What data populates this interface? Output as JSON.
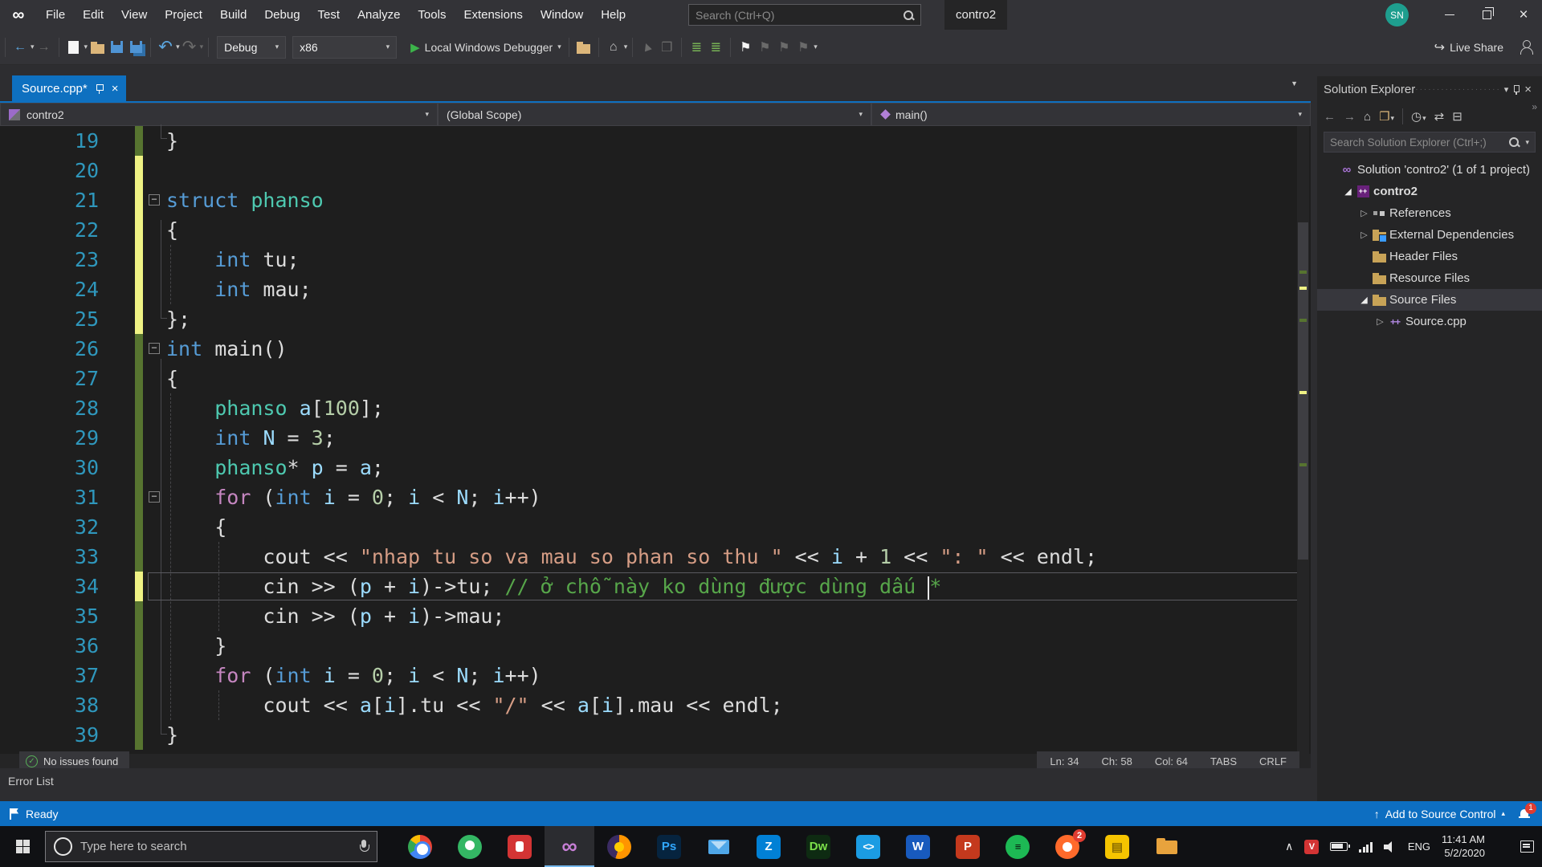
{
  "colors": {
    "accent_blue": "#0E70C0",
    "statusbar_blue": "#0D6EC1",
    "modified_yellow": "#EFF284",
    "saved_green": "#577430",
    "avatar_teal": "#1E9E8E"
  },
  "title_bar": {
    "menus": [
      "File",
      "Edit",
      "View",
      "Project",
      "Build",
      "Debug",
      "Test",
      "Analyze",
      "Tools",
      "Extensions",
      "Window",
      "Help"
    ],
    "search_placeholder": "Search (Ctrl+Q)",
    "window_title": "contro2",
    "avatar_initials": "SN"
  },
  "toolbar": {
    "configuration": "Debug",
    "platform": "x86",
    "run_label": "Local Windows Debugger",
    "live_share": "Live Share"
  },
  "editor": {
    "tab_label": "Source.cpp*",
    "navbar": {
      "project": "contro2",
      "scope": "(Global Scope)",
      "member": "main()"
    },
    "first_line": 19,
    "lines": [
      {
        "n": 19,
        "gutter": "g",
        "seg": [
          {
            "c": "pl",
            "t": "}"
          }
        ]
      },
      {
        "n": 20,
        "gutter": "y",
        "seg": []
      },
      {
        "n": 21,
        "gutter": "y",
        "fold": true,
        "seg": [
          {
            "c": "kw",
            "t": "struct"
          },
          {
            "c": "pl",
            "t": " "
          },
          {
            "c": "type",
            "t": "phanso"
          }
        ]
      },
      {
        "n": 22,
        "gutter": "y",
        "seg": [
          {
            "c": "pl",
            "t": "{"
          }
        ]
      },
      {
        "n": 23,
        "gutter": "y",
        "seg": [
          {
            "c": "pl",
            "t": "    "
          },
          {
            "c": "kw",
            "t": "int"
          },
          {
            "c": "pl",
            "t": " tu;"
          }
        ]
      },
      {
        "n": 24,
        "gutter": "y",
        "seg": [
          {
            "c": "pl",
            "t": "    "
          },
          {
            "c": "kw",
            "t": "int"
          },
          {
            "c": "pl",
            "t": " mau;"
          }
        ]
      },
      {
        "n": 25,
        "gutter": "y",
        "seg": [
          {
            "c": "pl",
            "t": "};"
          }
        ]
      },
      {
        "n": 26,
        "gutter": "g",
        "fold": true,
        "seg": [
          {
            "c": "kw",
            "t": "int"
          },
          {
            "c": "pl",
            "t": " main()"
          }
        ]
      },
      {
        "n": 27,
        "gutter": "g",
        "seg": [
          {
            "c": "pl",
            "t": "{"
          }
        ]
      },
      {
        "n": 28,
        "gutter": "g",
        "seg": [
          {
            "c": "pl",
            "t": "    "
          },
          {
            "c": "type",
            "t": "phanso"
          },
          {
            "c": "pl",
            "t": " "
          },
          {
            "c": "var",
            "t": "a"
          },
          {
            "c": "pl",
            "t": "["
          },
          {
            "c": "num",
            "t": "100"
          },
          {
            "c": "pl",
            "t": "];"
          }
        ]
      },
      {
        "n": 29,
        "gutter": "g",
        "seg": [
          {
            "c": "pl",
            "t": "    "
          },
          {
            "c": "kw",
            "t": "int"
          },
          {
            "c": "pl",
            "t": " "
          },
          {
            "c": "var",
            "t": "N"
          },
          {
            "c": "pl",
            "t": " = "
          },
          {
            "c": "num",
            "t": "3"
          },
          {
            "c": "pl",
            "t": ";"
          }
        ]
      },
      {
        "n": 30,
        "gutter": "g",
        "seg": [
          {
            "c": "pl",
            "t": "    "
          },
          {
            "c": "type",
            "t": "phanso"
          },
          {
            "c": "pl",
            "t": "* "
          },
          {
            "c": "var",
            "t": "p"
          },
          {
            "c": "pl",
            "t": " = "
          },
          {
            "c": "var",
            "t": "a"
          },
          {
            "c": "pl",
            "t": ";"
          }
        ]
      },
      {
        "n": 31,
        "gutter": "g",
        "fold": true,
        "seg": [
          {
            "c": "pl",
            "t": "    "
          },
          {
            "c": "ctl",
            "t": "for"
          },
          {
            "c": "pl",
            "t": " ("
          },
          {
            "c": "kw",
            "t": "int"
          },
          {
            "c": "pl",
            "t": " "
          },
          {
            "c": "var",
            "t": "i"
          },
          {
            "c": "pl",
            "t": " = "
          },
          {
            "c": "num",
            "t": "0"
          },
          {
            "c": "pl",
            "t": "; "
          },
          {
            "c": "var",
            "t": "i"
          },
          {
            "c": "pl",
            "t": " < "
          },
          {
            "c": "var",
            "t": "N"
          },
          {
            "c": "pl",
            "t": "; "
          },
          {
            "c": "var",
            "t": "i"
          },
          {
            "c": "pl",
            "t": "++)"
          }
        ]
      },
      {
        "n": 32,
        "gutter": "g",
        "seg": [
          {
            "c": "pl",
            "t": "    {"
          }
        ]
      },
      {
        "n": 33,
        "gutter": "g",
        "seg": [
          {
            "c": "pl",
            "t": "        cout << "
          },
          {
            "c": "str",
            "t": "\"nhap tu so va mau so phan so thu \""
          },
          {
            "c": "pl",
            "t": " << "
          },
          {
            "c": "var",
            "t": "i"
          },
          {
            "c": "pl",
            "t": " + "
          },
          {
            "c": "num",
            "t": "1"
          },
          {
            "c": "pl",
            "t": " << "
          },
          {
            "c": "str",
            "t": "\": \""
          },
          {
            "c": "pl",
            "t": " << endl;"
          }
        ]
      },
      {
        "n": 34,
        "gutter": "y",
        "current": true,
        "seg": [
          {
            "c": "pl",
            "t": "        cin >> ("
          },
          {
            "c": "var",
            "t": "p"
          },
          {
            "c": "pl",
            "t": " + "
          },
          {
            "c": "var",
            "t": "i"
          },
          {
            "c": "pl",
            "t": ")->tu; "
          },
          {
            "c": "com",
            "t": "// ở chỗ này ko dùng được dùng dấu "
          },
          {
            "c": "caret",
            "t": ""
          },
          {
            "c": "com",
            "t": "*"
          }
        ]
      },
      {
        "n": 35,
        "gutter": "g",
        "seg": [
          {
            "c": "pl",
            "t": "        cin >> ("
          },
          {
            "c": "var",
            "t": "p"
          },
          {
            "c": "pl",
            "t": " + "
          },
          {
            "c": "var",
            "t": "i"
          },
          {
            "c": "pl",
            "t": ")->mau;"
          }
        ]
      },
      {
        "n": 36,
        "gutter": "g",
        "seg": [
          {
            "c": "pl",
            "t": "    }"
          }
        ]
      },
      {
        "n": 37,
        "gutter": "g",
        "seg": [
          {
            "c": "pl",
            "t": "    "
          },
          {
            "c": "ctl",
            "t": "for"
          },
          {
            "c": "pl",
            "t": " ("
          },
          {
            "c": "kw",
            "t": "int"
          },
          {
            "c": "pl",
            "t": " "
          },
          {
            "c": "var",
            "t": "i"
          },
          {
            "c": "pl",
            "t": " = "
          },
          {
            "c": "num",
            "t": "0"
          },
          {
            "c": "pl",
            "t": "; "
          },
          {
            "c": "var",
            "t": "i"
          },
          {
            "c": "pl",
            "t": " < "
          },
          {
            "c": "var",
            "t": "N"
          },
          {
            "c": "pl",
            "t": "; "
          },
          {
            "c": "var",
            "t": "i"
          },
          {
            "c": "pl",
            "t": "++)"
          }
        ]
      },
      {
        "n": 38,
        "gutter": "g",
        "seg": [
          {
            "c": "pl",
            "t": "        cout << "
          },
          {
            "c": "var",
            "t": "a"
          },
          {
            "c": "pl",
            "t": "["
          },
          {
            "c": "var",
            "t": "i"
          },
          {
            "c": "pl",
            "t": "].tu << "
          },
          {
            "c": "str",
            "t": "\"/\""
          },
          {
            "c": "pl",
            "t": " << "
          },
          {
            "c": "var",
            "t": "a"
          },
          {
            "c": "pl",
            "t": "["
          },
          {
            "c": "var",
            "t": "i"
          },
          {
            "c": "pl",
            "t": "].mau << endl;"
          }
        ]
      },
      {
        "n": 39,
        "gutter": "g",
        "seg": [
          {
            "c": "pl",
            "t": "}"
          }
        ]
      }
    ],
    "health": "No issues found",
    "status_items": [
      "Ln: 34",
      "Ch: 58",
      "Col: 64",
      "TABS",
      "CRLF"
    ]
  },
  "solution_explorer": {
    "title": "Solution Explorer",
    "search_placeholder": "Search Solution Explorer (Ctrl+;)",
    "tree": [
      {
        "label": "Solution 'contro2' (1 of 1 project)",
        "indent": 0,
        "icon": "solution",
        "expand": "none"
      },
      {
        "label": "contro2",
        "indent": 1,
        "icon": "project",
        "expand": "open",
        "bold": true
      },
      {
        "label": "References",
        "indent": 2,
        "icon": "ref",
        "expand": "closed"
      },
      {
        "label": "External Dependencies",
        "indent": 2,
        "icon": "folder-ext",
        "expand": "closed"
      },
      {
        "label": "Header Files",
        "indent": 2,
        "icon": "folder",
        "expand": "none"
      },
      {
        "label": "Resource Files",
        "indent": 2,
        "icon": "folder",
        "expand": "none"
      },
      {
        "label": "Source Files",
        "indent": 2,
        "icon": "folder",
        "expand": "open",
        "selected": true
      },
      {
        "label": "Source.cpp",
        "indent": 3,
        "icon": "cpp",
        "expand": "closed"
      }
    ]
  },
  "error_list": {
    "title": "Error List"
  },
  "status_bar": {
    "ready": "Ready",
    "source_control": "Add to Source Control",
    "notification_count": "1"
  },
  "taskbar": {
    "search_placeholder": "Type here to search",
    "apps": [
      {
        "name": "chrome",
        "kind": "chrome"
      },
      {
        "name": "coccoc-browser",
        "kind": "coccoc"
      },
      {
        "name": "red-security-app",
        "kind": "redlock"
      },
      {
        "name": "visual-studio",
        "kind": "vstudio",
        "label": "∞",
        "active": true
      },
      {
        "name": "firefox",
        "kind": "firefox"
      },
      {
        "name": "photoshop",
        "kind": "ps",
        "label": "Ps"
      },
      {
        "name": "mail",
        "kind": "mail"
      },
      {
        "name": "zalo-chat",
        "kind": "zalo",
        "label": "Z"
      },
      {
        "name": "dreamweaver",
        "kind": "dw",
        "label": "Dw"
      },
      {
        "name": "vs-code",
        "kind": "vscode",
        "label": "<>"
      },
      {
        "name": "word",
        "kind": "word",
        "label": "W"
      },
      {
        "name": "powerpoint",
        "kind": "pp",
        "label": "P"
      },
      {
        "name": "spotify",
        "kind": "spotify",
        "label": "≡"
      },
      {
        "name": "orange-browser",
        "kind": "orange",
        "badge": "2"
      },
      {
        "name": "sticky-notes",
        "kind": "notes",
        "label": "▤"
      },
      {
        "name": "file-explorer",
        "kind": "folder"
      }
    ],
    "tray": {
      "language": "ENG",
      "time": "11:41 AM",
      "date": "5/2/2020"
    }
  }
}
